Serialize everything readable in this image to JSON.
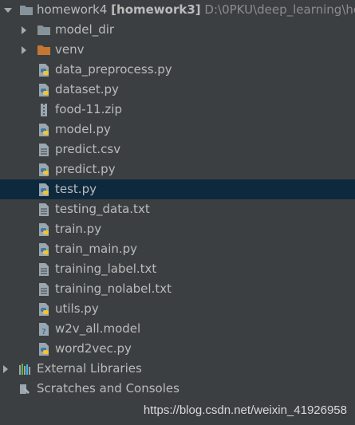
{
  "project": {
    "name": "homework4",
    "module": "[homework3]",
    "path": "D:\\0PKU\\deep_learning\\ho"
  },
  "items": [
    {
      "label": "model_dir",
      "icon": "folder-icon"
    },
    {
      "label": "venv",
      "icon": "excluded-folder-icon"
    },
    {
      "label": "data_preprocess.py",
      "icon": "python-file-icon"
    },
    {
      "label": "dataset.py",
      "icon": "python-file-icon"
    },
    {
      "label": "food-11.zip",
      "icon": "archive-file-icon"
    },
    {
      "label": "model.py",
      "icon": "python-file-icon"
    },
    {
      "label": "predict.csv",
      "icon": "text-file-icon"
    },
    {
      "label": "predict.py",
      "icon": "python-file-icon"
    },
    {
      "label": "test.py",
      "icon": "python-file-icon",
      "selected": true
    },
    {
      "label": "testing_data.txt",
      "icon": "text-file-icon"
    },
    {
      "label": "train.py",
      "icon": "python-file-icon"
    },
    {
      "label": "train_main.py",
      "icon": "python-file-icon"
    },
    {
      "label": "training_label.txt",
      "icon": "text-file-icon"
    },
    {
      "label": "training_nolabel.txt",
      "icon": "text-file-icon"
    },
    {
      "label": "utils.py",
      "icon": "python-file-icon"
    },
    {
      "label": "w2v_all.model",
      "icon": "unknown-file-icon"
    },
    {
      "label": "word2vec.py",
      "icon": "python-file-icon"
    }
  ],
  "external_libraries": {
    "label": "External Libraries",
    "icon": "library-icon"
  },
  "scratches": {
    "label": "Scratches and Consoles",
    "icon": "scratches-icon"
  },
  "watermark": "https://blog.csdn.net/weixin_41926958",
  "colors": {
    "background": "#3c3f41",
    "selected_row": "#0d293e",
    "text": "#bbbbbb",
    "path_text": "#8c8c8c",
    "folder": "#87939a",
    "excluded_folder": "#c57633",
    "python_blue": "#3c78aa",
    "python_yellow": "#f4c430"
  }
}
